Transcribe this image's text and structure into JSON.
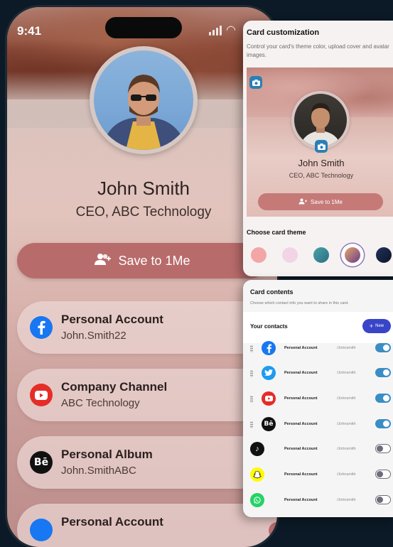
{
  "phone": {
    "status_time": "9:41",
    "name": "John Smith",
    "title": "CEO, ABC Technology",
    "save_label": "Save to 1Me",
    "accounts": [
      {
        "label": "Personal Account",
        "sub": "John.Smith22",
        "icon": "facebook-icon"
      },
      {
        "label": "Company Channel",
        "sub": "ABC Technology",
        "icon": "youtube-icon"
      },
      {
        "label": "Personal Album",
        "sub": "John.SmithABC",
        "icon": "behance-icon"
      },
      {
        "label": "Personal Account",
        "sub": "",
        "icon": "facebook-icon"
      }
    ]
  },
  "customization": {
    "title": "Card customization",
    "description": "Control your card's theme color, upload cover and avatar images.",
    "name": "John Smith",
    "role": "CEO, ABC Technology",
    "save_label": "Save to 1Me",
    "theme_title": "Choose card theme",
    "themes": [
      "#f3a6a6",
      "#f2d4e6",
      "#3a8e97",
      "#7b5a8a",
      "#14233e"
    ],
    "selected_theme_index": 3
  },
  "contents": {
    "title": "Card contents",
    "description": "Choose which contact info you want to share in this card.",
    "your_contacts": "Your contacts",
    "new_label": "New",
    "rows": [
      {
        "icon": "facebook-icon",
        "label": "Personal Account",
        "value": "/Johnsmith",
        "on": true,
        "draggable": true
      },
      {
        "icon": "twitter-icon",
        "label": "Personal Account",
        "value": "/Johnsmith",
        "on": true,
        "draggable": true
      },
      {
        "icon": "youtube-icon",
        "label": "Personal Account",
        "value": "/Johnsmith",
        "on": true,
        "draggable": true
      },
      {
        "icon": "behance-icon",
        "label": "Personal Account",
        "value": "/Johnsmith",
        "on": true,
        "draggable": true
      },
      {
        "icon": "tiktok-icon",
        "label": "Personal Account",
        "value": "/Johnsmith",
        "on": false,
        "draggable": false
      },
      {
        "icon": "snapchat-icon",
        "label": "Personal Account",
        "value": "/Johnsmith",
        "on": false,
        "draggable": false
      },
      {
        "icon": "whatsapp-icon",
        "label": "Personal Account",
        "value": "/Johnsmith",
        "on": false,
        "draggable": false
      }
    ]
  }
}
